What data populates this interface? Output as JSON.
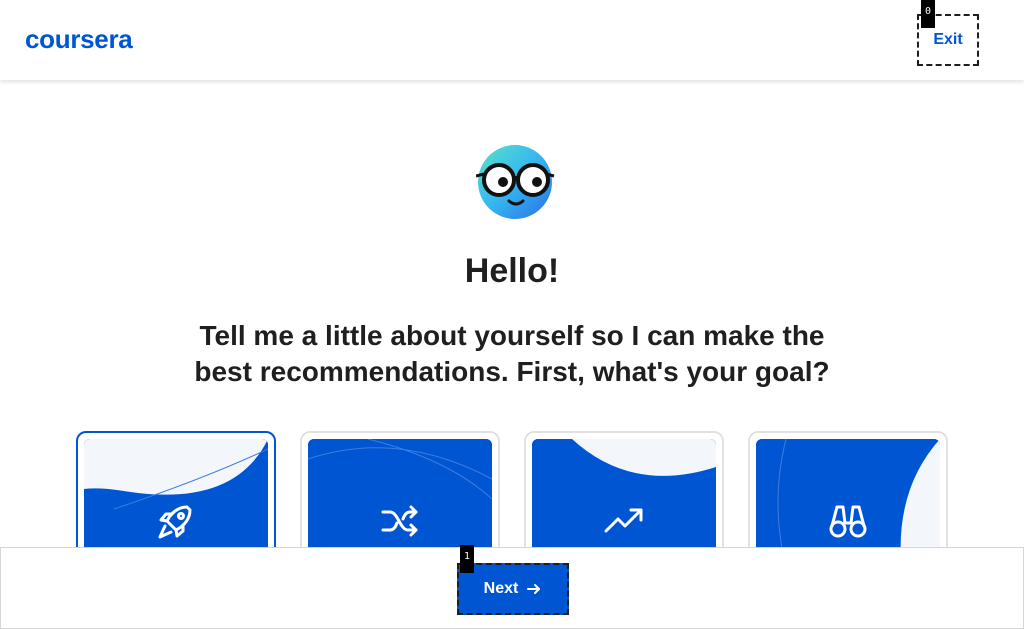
{
  "header": {
    "logo_text": "coursera",
    "exit_label": "Exit"
  },
  "som_tags": {
    "exit": "0",
    "next": "1"
  },
  "main": {
    "avatar_icon": "nerd-face-glasses-icon",
    "greeting": "Hello!",
    "prompt": "Tell me a little about yourself so I can make the best recommendations. First, what's your goal?"
  },
  "goal_cards": [
    {
      "icon": "rocket-icon",
      "selected": true
    },
    {
      "icon": "shuffle-icon",
      "selected": false
    },
    {
      "icon": "trending-up-icon",
      "selected": false
    },
    {
      "icon": "binoculars-icon",
      "selected": false
    }
  ],
  "footer": {
    "next_label": "Next",
    "next_icon": "arrow-right-icon"
  },
  "colors": {
    "brand_blue": "#0056d2",
    "text": "#1f1f1f",
    "card_border": "#e1e1e1"
  }
}
